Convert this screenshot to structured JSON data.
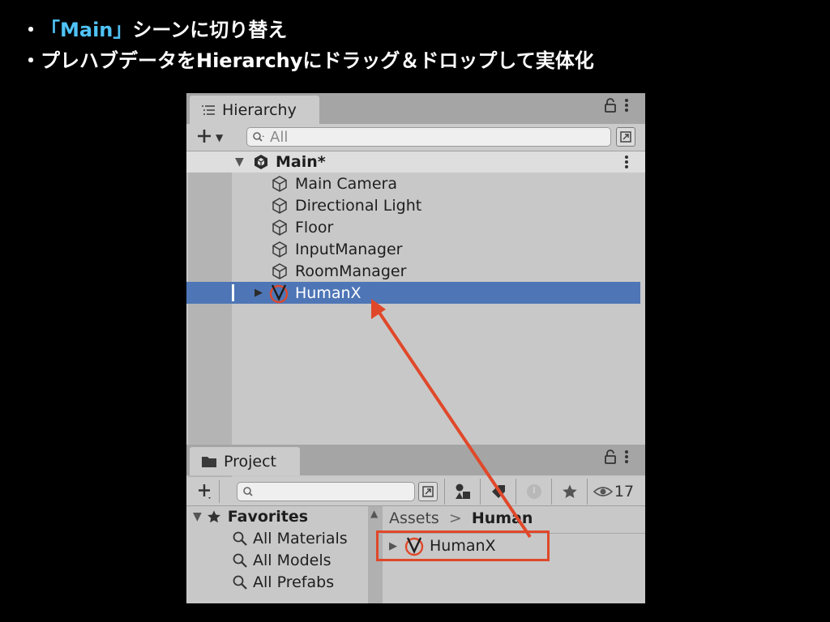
{
  "slide": {
    "bullet1_prefix": "・",
    "bullet1_highlight": "「Main」",
    "bullet1_rest": "シーンに切り替え",
    "bullet2_prefix": "・",
    "bullet2_text": "プレハブデータをHierarchyにドラッグ＆ドロップして実体化"
  },
  "hierarchy": {
    "tab_label": "Hierarchy",
    "search_placeholder": "All",
    "scene_name": "Main*",
    "items": [
      {
        "label": "Main Camera",
        "type": "gameobject"
      },
      {
        "label": "Directional Light",
        "type": "gameobject"
      },
      {
        "label": "Floor",
        "type": "gameobject"
      },
      {
        "label": "InputManager",
        "type": "gameobject"
      },
      {
        "label": "RoomManager",
        "type": "gameobject"
      },
      {
        "label": "HumanX",
        "type": "prefab",
        "selected": true
      }
    ]
  },
  "project": {
    "tab_label": "Project",
    "hidden_count": "17",
    "favorites_label": "Favorites",
    "favorites": [
      "All Materials",
      "All Models",
      "All Prefabs"
    ],
    "breadcrumb_root": "Assets",
    "breadcrumb_sep": ">",
    "breadcrumb_current": "Human",
    "assets": [
      {
        "label": "HumanX",
        "type": "prefab"
      }
    ]
  },
  "colors": {
    "selection": "#4e76b6",
    "annotation_red": "#e0482a",
    "highlight_cyan": "#4fc3f7"
  }
}
